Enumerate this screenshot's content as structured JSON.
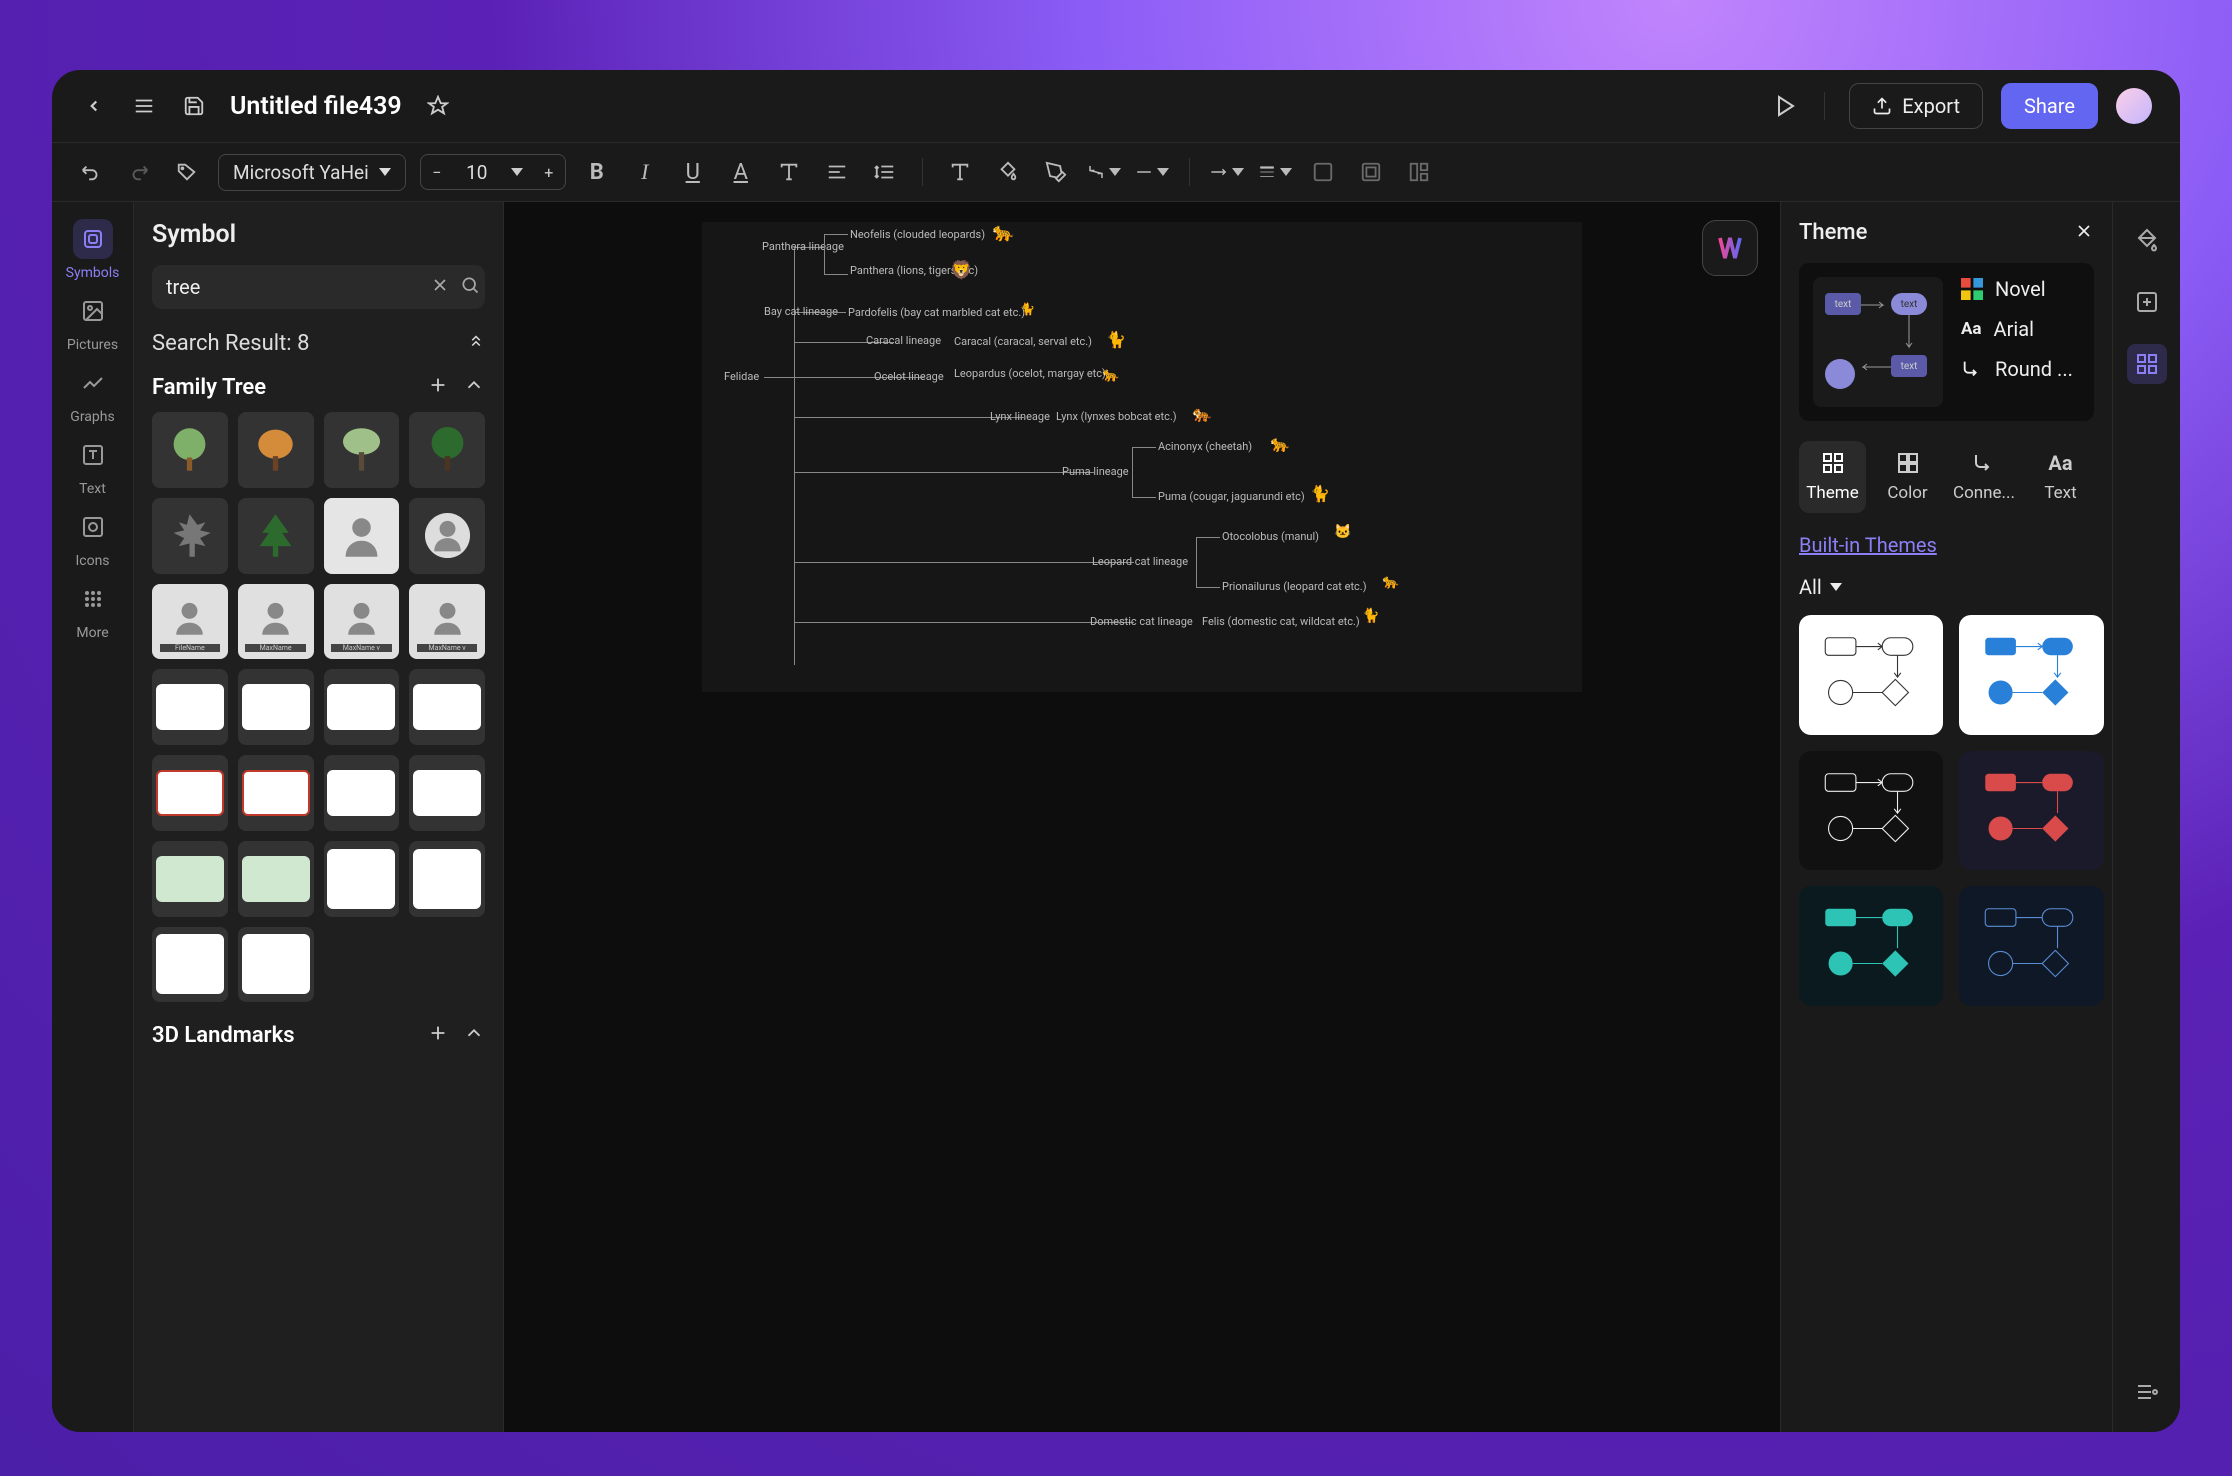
{
  "titlebar": {
    "filename": "Untitled file439",
    "export_label": "Export",
    "share_label": "Share"
  },
  "toolbar": {
    "font_name": "Microsoft YaHei",
    "font_size": "10"
  },
  "left_rail": {
    "items": [
      "Symbols",
      "Pictures",
      "Graphs",
      "Text",
      "Icons",
      "More"
    ]
  },
  "symbol_panel": {
    "title": "Symbol",
    "search_value": "tree",
    "result_label": "Search Result: 8",
    "category1": "Family Tree",
    "category2": "3D Landmarks"
  },
  "right_panel": {
    "title": "Theme",
    "scheme": "Novel",
    "font": "Arial",
    "connector": "Round ...",
    "tabs": [
      "Theme",
      "Color",
      "Conne...",
      "Text"
    ],
    "section": "Built-in Themes",
    "filter": "All"
  },
  "diagram": {
    "root": "Felidae",
    "nodes": [
      "Panthera lineage",
      "Neofelis (clouded leopards)",
      "Panthera (lions, tigers etc)",
      "Bay cat lineage",
      "Pardofelis (bay cat marbled cat etc.)",
      "Caracal lineage",
      "Caracal (caracal, serval etc.)",
      "Ocelot lineage",
      "Leopardus (ocelot, margay etc)",
      "Lynx lineage",
      "Lynx (lynxes bobcat etc.)",
      "Puma lineage",
      "Acinonyx (cheetah)",
      "Puma (cougar, jaguarundi etc)",
      "Leopard cat lineage",
      "Otocolobus (manul)",
      "Prionailurus (leopard cat etc.)",
      "Domestic cat lineage",
      "Felis (domestic cat, wildcat etc.)"
    ]
  }
}
